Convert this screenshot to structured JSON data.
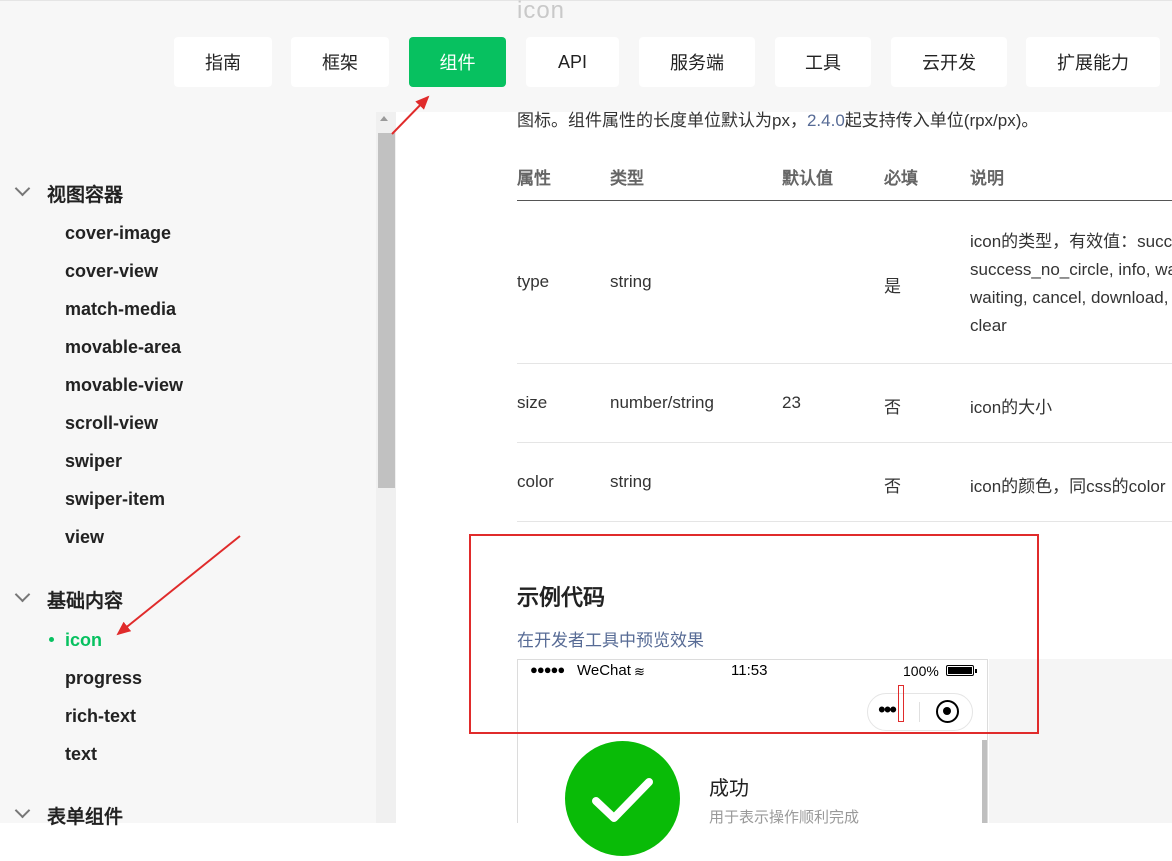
{
  "nav": {
    "ghost_title": "icon",
    "tabs": [
      {
        "label": "指南"
      },
      {
        "label": "框架"
      },
      {
        "label": "组件"
      },
      {
        "label": "API"
      },
      {
        "label": "服务端"
      },
      {
        "label": "工具"
      },
      {
        "label": "云开发"
      },
      {
        "label": "扩展能力"
      }
    ],
    "active_tab": "组件"
  },
  "sidebar": {
    "groups": [
      {
        "label": "视图容器",
        "items": [
          "cover-image",
          "cover-view",
          "match-media",
          "movable-area",
          "movable-view",
          "scroll-view",
          "swiper",
          "swiper-item",
          "view"
        ]
      },
      {
        "label": "基础内容",
        "items": [
          "icon",
          "progress",
          "rich-text",
          "text"
        ]
      },
      {
        "label": "表单组件",
        "items": []
      }
    ],
    "active_item": "icon"
  },
  "main": {
    "intro": {
      "before": "图标。组件属性的长度单位默认为px，",
      "link": "2.4.0",
      "after": "起支持传入单位(rpx/px)。"
    },
    "table": {
      "headers": [
        "属性",
        "类型",
        "默认值",
        "必填",
        "说明"
      ],
      "rows": [
        {
          "attr": "type",
          "type": "string",
          "default": "",
          "required": "是",
          "desc": [
            "icon的类型，有效值：success,",
            "success_no_circle, info, warn,",
            "waiting, cancel, download, search,",
            "clear"
          ]
        },
        {
          "attr": "size",
          "type": "number/string",
          "default": "23",
          "required": "否",
          "desc": [
            "icon的大小"
          ]
        },
        {
          "attr": "color",
          "type": "string",
          "default": "",
          "required": "否",
          "desc": [
            "icon的颜色，同css的color"
          ]
        }
      ]
    },
    "example": {
      "title": "示例代码",
      "preview_link": "在开发者工具中预览效果"
    },
    "phone": {
      "signal": "●●●●●",
      "carrier": "WeChat",
      "wifi": "≋",
      "time": "11:53",
      "battery_pct": "100%",
      "capsule_more": "•••",
      "success_title": "成功",
      "success_desc": "用于表示操作顺利完成"
    }
  },
  "colors": {
    "accent": "#07c160",
    "link": "#576b95",
    "annotation": "#e02b2b",
    "success_icon": "#09bb07"
  }
}
